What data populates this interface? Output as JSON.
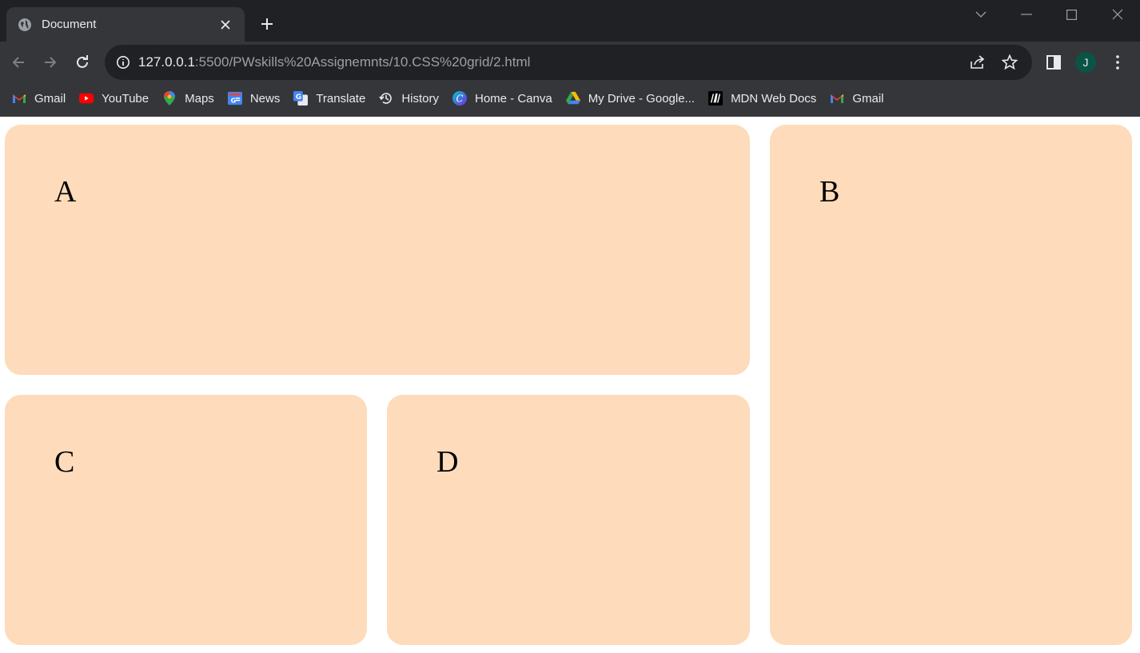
{
  "browser": {
    "tab_title": "Document",
    "url_host": "127.0.0.1",
    "url_rest": ":5500/PWskills%20Assignemnts/10.CSS%20grid/2.html",
    "avatar_initial": "J"
  },
  "bookmarks": [
    {
      "label": "Gmail",
      "icon": "gmail-icon"
    },
    {
      "label": "YouTube",
      "icon": "youtube-icon"
    },
    {
      "label": "Maps",
      "icon": "maps-icon"
    },
    {
      "label": "News",
      "icon": "news-icon"
    },
    {
      "label": "Translate",
      "icon": "translate-icon"
    },
    {
      "label": "History",
      "icon": "history-icon"
    },
    {
      "label": "Home - Canva",
      "icon": "canva-icon"
    },
    {
      "label": "My Drive - Google...",
      "icon": "drive-icon"
    },
    {
      "label": "MDN Web Docs",
      "icon": "mdn-icon"
    },
    {
      "label": "Gmail",
      "icon": "gmail-icon"
    }
  ],
  "grid": {
    "a": "A",
    "b": "B",
    "c": "C",
    "d": "D",
    "box_color": "#fddbbb"
  }
}
